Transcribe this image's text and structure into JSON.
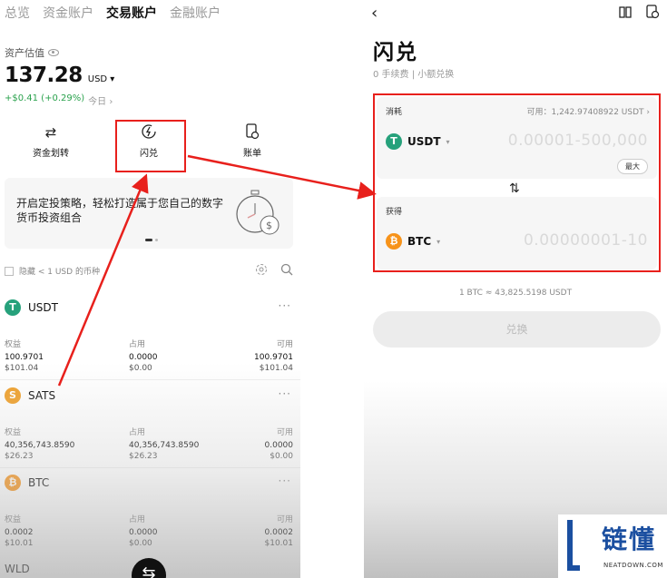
{
  "left": {
    "tabs": [
      "总览",
      "资金账户",
      "交易账户",
      "金融账户"
    ],
    "active_tab": "交易账户",
    "asset_label": "资产估值",
    "asset_value": "137.28",
    "asset_unit": "USD ▾",
    "asset_change": "+$0.41 (+0.29%)",
    "asset_change_period": "今日 ›",
    "quick_actions": [
      {
        "label": "资金划转",
        "icon": "transfer-icon"
      },
      {
        "label": "闪兑",
        "icon": "flash-swap-icon"
      },
      {
        "label": "账单",
        "icon": "bill-icon"
      }
    ],
    "banner_text": "开启定投策略，轻松打造属于您自己的数字货币投资组合",
    "filter_label": "隐藏 < 1 USD 的币种",
    "coins": [
      {
        "symbol": "USDT",
        "logo": "T",
        "equity_label": "权益",
        "equity": "100.9701",
        "equity_usd": "$101.04",
        "used_label": "占用",
        "used": "0.0000",
        "used_usd": "$0.00",
        "avail_label": "可用",
        "avail": "100.9701",
        "avail_usd": "$101.04"
      },
      {
        "symbol": "SATS",
        "logo": "S",
        "equity_label": "权益",
        "equity": "40,356,743.8590",
        "equity_usd": "$26.23",
        "used_label": "占用",
        "used": "40,356,743.8590",
        "used_usd": "$26.23",
        "avail_label": "可用",
        "avail": "0.0000",
        "avail_usd": "$0.00"
      },
      {
        "symbol": "BTC",
        "logo": "₿",
        "equity_label": "权益",
        "equity": "0.0002",
        "equity_usd": "$10.01",
        "used_label": "占用",
        "used": "0.0000",
        "used_usd": "$0.00",
        "avail_label": "可用",
        "avail": "0.0002",
        "avail_usd": "$10.01"
      }
    ],
    "partial_coin": "WLD"
  },
  "right": {
    "title": "闪兑",
    "subtitle": "0 手续费 | 小额兑换",
    "spend_label": "消耗",
    "available": "可用：1,242.97408922 USDT ›",
    "from_token": "USDT",
    "from_range": "0.00001-500,000",
    "max_label": "最大",
    "receive_label": "获得",
    "to_token": "BTC",
    "to_range": "0.00000001-10",
    "rate": "1 BTC ≈ 43,825.5198 USDT",
    "convert_label": "兑换"
  },
  "watermark": {
    "name": "链懂",
    "domain": "NEATDOWN.COM"
  },
  "colors": {
    "highlight": "#e8201c",
    "up": "#2aa24d",
    "usdt": "#26a17b",
    "btc": "#f7931a",
    "sats": "#f0a12c"
  }
}
